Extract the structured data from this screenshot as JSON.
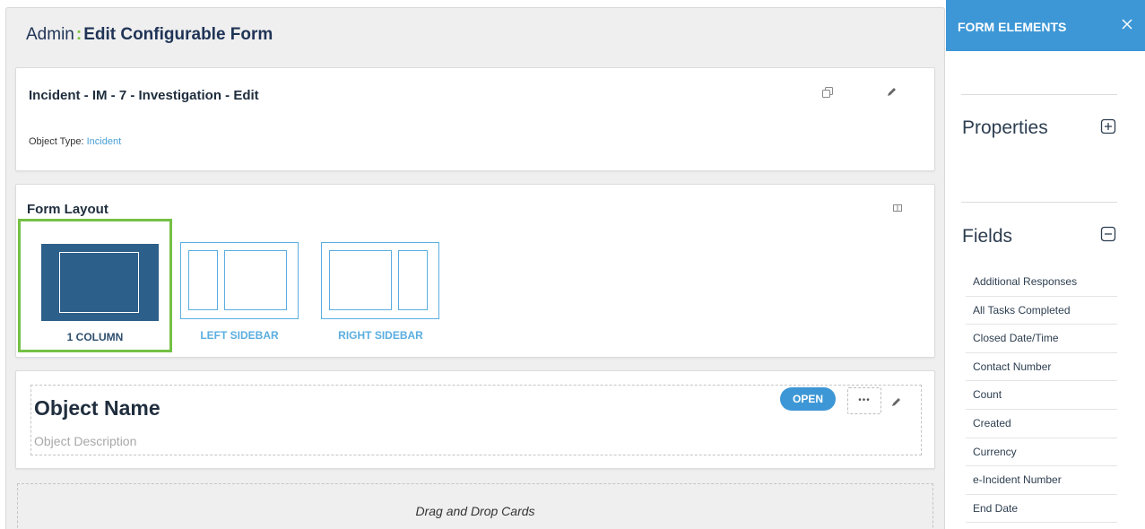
{
  "header": {
    "prefix": "Admin",
    "separator": ":",
    "title": "Edit Configurable Form"
  },
  "incident_card": {
    "title": "Incident - IM - 7 - Investigation - Edit",
    "object_type_label": "Object Type:",
    "object_type_value": "Incident"
  },
  "form_layout": {
    "title": "Form Layout",
    "options": [
      {
        "label": "1 COLUMN",
        "selected": true
      },
      {
        "label": "LEFT SIDEBAR",
        "selected": false
      },
      {
        "label": "RIGHT SIDEBAR",
        "selected": false
      }
    ]
  },
  "object_card": {
    "name": "Object Name",
    "description": "Object Description",
    "status": "OPEN",
    "more_label": "•••"
  },
  "dropzone": {
    "text": "Drag and Drop Cards"
  },
  "panel": {
    "title": "FORM ELEMENTS",
    "properties_title": "Properties",
    "fields_title": "Fields",
    "fields": [
      "Additional Responses",
      "All Tasks Completed",
      "Closed Date/Time",
      "Contact Number",
      "Count",
      "Created",
      "Currency",
      "e-Incident Number",
      "End Date"
    ]
  },
  "colors": {
    "accent_blue": "#3d97d6",
    "selected_green": "#74c044",
    "layout_dark": "#2d5f8b",
    "link_blue": "#4a9fd8"
  },
  "icons": [
    "copy-icon",
    "pencil-icon",
    "columns-icon",
    "close-icon",
    "plus-box-icon",
    "minus-box-icon"
  ]
}
